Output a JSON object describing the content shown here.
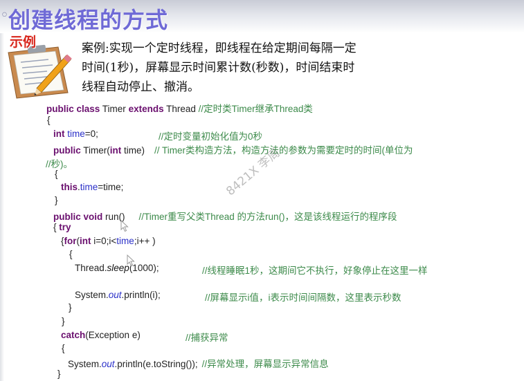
{
  "slide": {
    "title": "创建线程的方式",
    "example_badge": "示例",
    "case_lines": [
      "案例:实现一个定时线程，即线程在给定期间每隔一定",
      "时间(1秒)，屏幕显示时间累计数(秒数)，时间结束时",
      "线程自动停止、撤消。"
    ]
  },
  "watermark": "8421X 李周",
  "code": {
    "l1_kw": "public class",
    "l1_txt": " Timer ",
    "l1_kw2": "extends",
    "l1_txt2": " Thread ",
    "l1_cm": "//定时类Timer继承Thread类",
    "l2": "{",
    "l3_kw": "int",
    "l3_fld": " time",
    "l3_txt": "=0;",
    "l3_cm": "//定时变量初始化值为0秒",
    "l4_kw": "public",
    "l4_txt": " Timer(",
    "l4_kw2": "int",
    "l4_txt2": " time)",
    "l4_cm": "// Timer类构造方法，构造方法的参数为需要定时的时间(单位为",
    "l5_cm": "//秒)。",
    "l6": "{",
    "l7_kw": "this",
    "l7_txt": ".",
    "l7_fld": "time",
    "l7_txt2": "=time;",
    "l8": "}",
    "l9_kw": "public void",
    "l9_txt": " run()",
    "l9_cm": "//Timer重写父类Thread 的方法run()，这是该线程运行的程序段",
    "l10_txt": "{ ",
    "l10_kw": "try",
    "l11_txt": "{",
    "l11_kw": "for",
    "l11_txt2": "(",
    "l11_kw2": "int",
    "l11_txt3": " i=0;i<",
    "l11_fld": "time",
    "l11_txt4": ";i++ )",
    "l12": "{",
    "l13_txt": "Thread.",
    "l13_it": "sleep",
    "l13_txt2": "(1000);",
    "l13_cm": "//线程睡眠1秒，这期间它不执行，好象停止在这里一样",
    "l14_txt": "System.",
    "l14_it": "out",
    "l14_txt2": ".println(i);",
    "l14_cm": "//屏幕显示i值，i表示时间间隔数，这里表示秒数",
    "l15": "}",
    "l16": "}",
    "l17_kw": "catch",
    "l17_txt": "(Exception e)",
    "l17_cm": "//捕获异常",
    "l18": "{",
    "l19_txt": "System.",
    "l19_it": "out",
    "l19_txt2": ".println(e.toString());",
    "l19_cm": "//异常处理，屏幕显示异常信息",
    "l20": "}"
  },
  "icons": [
    "clipboard-pencil-icon",
    "mouse-cursor-icon",
    "title-bullet-icon"
  ],
  "colors": {
    "title": "#6f6ad6",
    "badge": "#d8261c",
    "keyword": "#6a0f6e",
    "field": "#2a2fc8",
    "comment": "#3c8a4a"
  }
}
